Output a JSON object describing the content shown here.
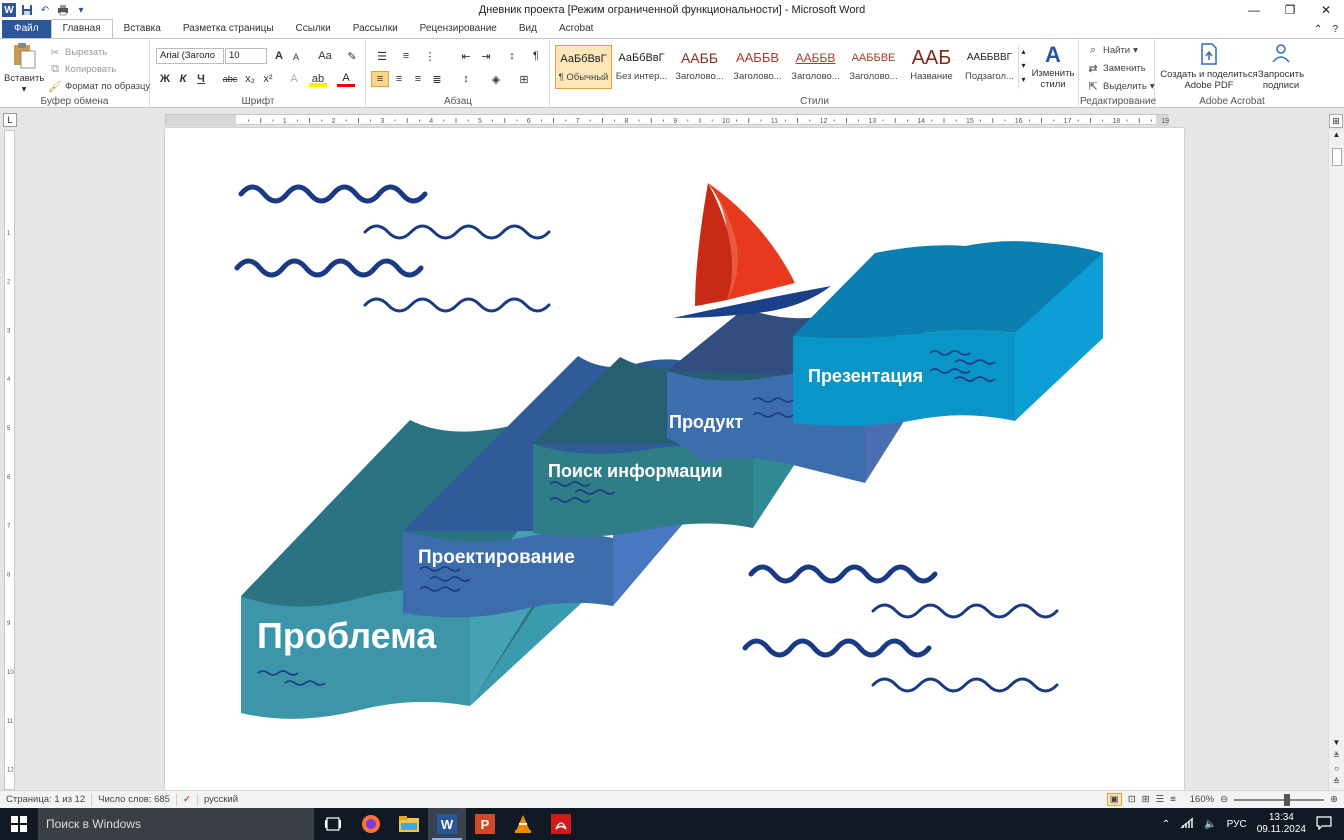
{
  "window": {
    "title": "Дневник проекта [Режим ограниченной функциональности]  -  Microsoft Word",
    "qat_app_icon": "W"
  },
  "tabs": [
    {
      "label": "Файл"
    },
    {
      "label": "Главная"
    },
    {
      "label": "Вставка"
    },
    {
      "label": "Разметка страницы"
    },
    {
      "label": "Ссылки"
    },
    {
      "label": "Рассылки"
    },
    {
      "label": "Рецензирование"
    },
    {
      "label": "Вид"
    },
    {
      "label": "Acrobat"
    }
  ],
  "ribbon": {
    "clipboard": {
      "paste": "Вставить",
      "cut": "Вырезать",
      "copy": "Копировать",
      "format_painter": "Формат по образцу",
      "group_label": "Буфер обмена"
    },
    "font": {
      "font_name": "Arial (Заголо",
      "font_size": "10",
      "grow": "A",
      "shrink": "A",
      "case": "Aa",
      "clear": "✎",
      "bold": "Ж",
      "italic": "К",
      "underline": "Ч",
      "strike": "abc",
      "sub": "x₂",
      "sup": "x²",
      "highlight": "ab",
      "color": "A",
      "effects": "A",
      "group_label": "Шрифт"
    },
    "paragraph": {
      "group_label": "Абзац",
      "pilcrow": "¶"
    },
    "styles": {
      "items": [
        {
          "sample": "АаБбВвГ",
          "name": "¶ Обычный"
        },
        {
          "sample": "АаБбВвГ",
          "name": "Без интер..."
        },
        {
          "sample": "ААББ",
          "name": "Заголово..."
        },
        {
          "sample": "ААББВ",
          "name": "Заголово..."
        },
        {
          "sample": "ААББВ",
          "name": "Заголово..."
        },
        {
          "sample": "ААББВЕ",
          "name": "Заголово..."
        },
        {
          "sample": "ААБ",
          "name": "Название"
        },
        {
          "sample": "ААББВВГ",
          "name": "Подзагол..."
        }
      ],
      "change_styles": "Изменить стили",
      "group_label": "Стили"
    },
    "editing": {
      "find": "Найти",
      "replace": "Заменить",
      "select": "Выделить",
      "group_label": "Редактирование"
    },
    "acrobat": {
      "create_pdf": "Создать и поделиться Adobe PDF",
      "request_sign": "Запросить подписи",
      "group_label": "Adobe Acrobat"
    }
  },
  "document": {
    "steps": [
      {
        "label": "Проблема",
        "color": "#3a95a8"
      },
      {
        "label": "Проектирование",
        "color": "#3b6fb2"
      },
      {
        "label": "Поиск информации",
        "color": "#2e7d87"
      },
      {
        "label": "Продукт",
        "color": "#3c6eae"
      },
      {
        "label": "Презентация",
        "color": "#0a95c8"
      }
    ],
    "sail_color": "#e8391e",
    "wave_color": "#1a3a84"
  },
  "status": {
    "page": "Страница: 1 из 12",
    "words": "Число слов: 685",
    "language": "русский",
    "zoom": "160%"
  },
  "taskbar": {
    "search_placeholder": "Поиск в Windows",
    "language": "РУС",
    "time": "13:34",
    "date": "09.11.2024"
  }
}
